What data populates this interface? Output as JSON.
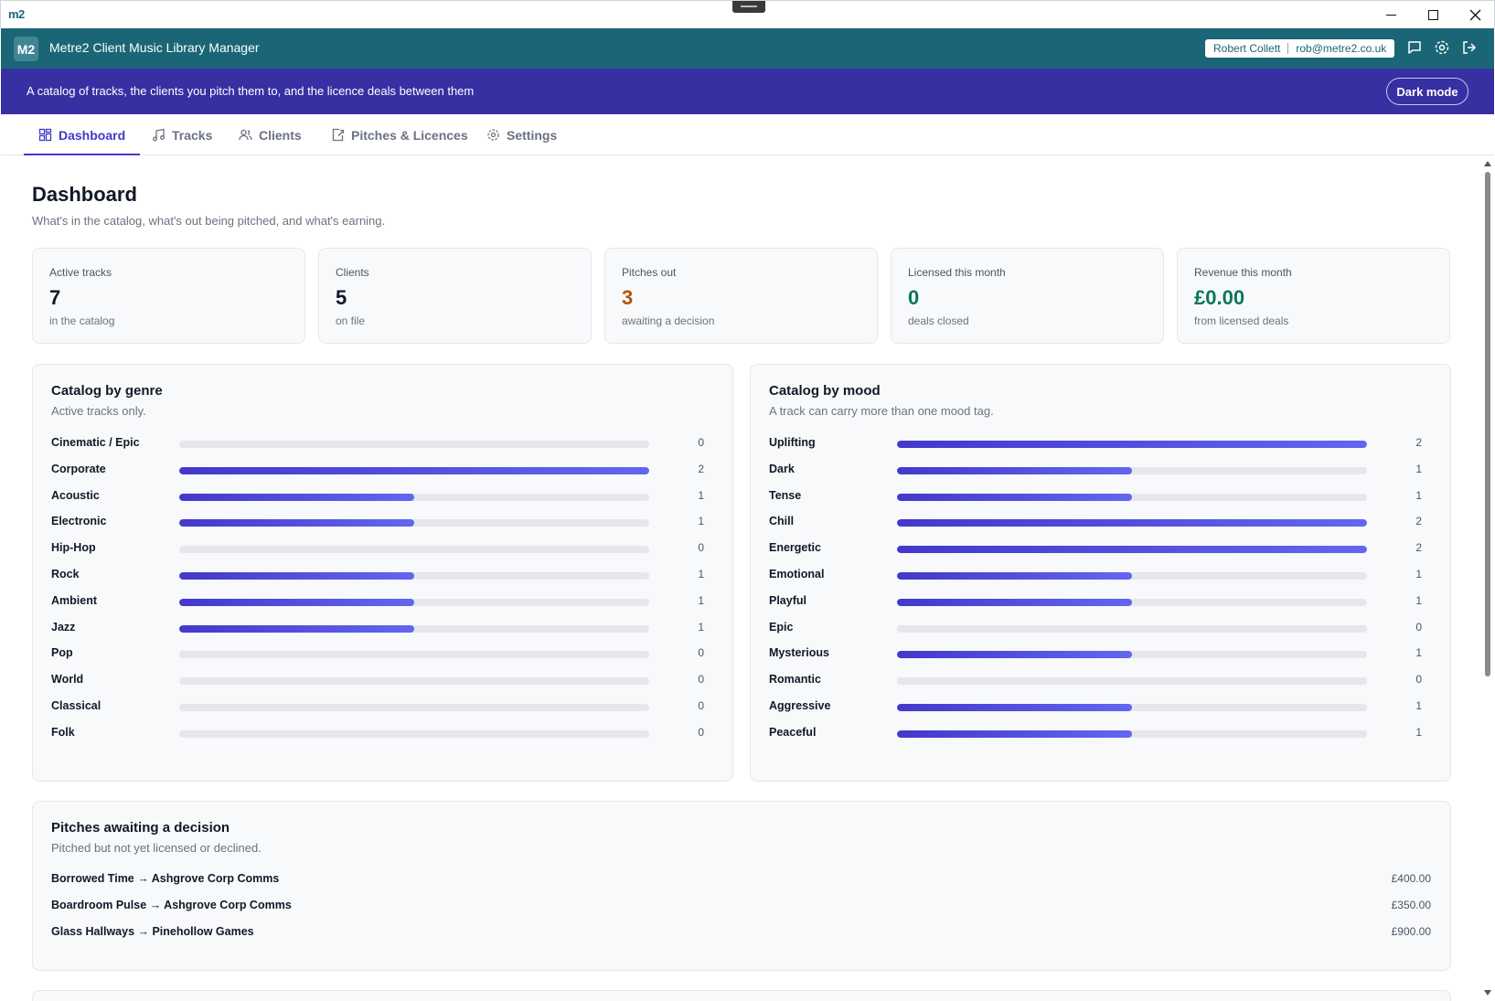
{
  "window": {
    "logo": "m2"
  },
  "header": {
    "badge": "M2",
    "title": "Metre2 Client Music Library Manager",
    "user_name": "Robert Collett",
    "user_email": "rob@metre2.co.uk"
  },
  "banner": {
    "text": "A catalog of tracks, the clients you pitch them to, and the licence deals between them",
    "dark_mode_label": "Dark mode"
  },
  "tabs": [
    {
      "label": "Dashboard",
      "icon": "dashboard-icon",
      "active": true
    },
    {
      "label": "Tracks",
      "icon": "music-note-icon",
      "active": false
    },
    {
      "label": "Clients",
      "icon": "users-icon",
      "active": false
    },
    {
      "label": "Pitches & Licences",
      "icon": "share-icon",
      "active": false
    },
    {
      "label": "Settings",
      "icon": "gear-icon",
      "active": false
    }
  ],
  "page": {
    "title": "Dashboard",
    "subtitle": "What's in the catalog, what's out being pitched, and what's earning."
  },
  "kpis": [
    {
      "label": "Active tracks",
      "value": "7",
      "sub": "in the catalog",
      "color": "#111827"
    },
    {
      "label": "Clients",
      "value": "5",
      "sub": "on file",
      "color": "#111827"
    },
    {
      "label": "Pitches out",
      "value": "3",
      "sub": "awaiting a decision",
      "color": "#b45309"
    },
    {
      "label": "Licensed this month",
      "value": "0",
      "sub": "deals closed",
      "color": "#047857"
    },
    {
      "label": "Revenue this month",
      "value": "£0.00",
      "sub": "from licensed deals",
      "color": "#047857"
    }
  ],
  "genre_panel": {
    "title": "Catalog by genre",
    "subtitle": "Active tracks only.",
    "max": 2,
    "rows": [
      {
        "label": "Cinematic / Epic",
        "count": 0
      },
      {
        "label": "Corporate",
        "count": 2
      },
      {
        "label": "Acoustic",
        "count": 1
      },
      {
        "label": "Electronic",
        "count": 1
      },
      {
        "label": "Hip-Hop",
        "count": 0
      },
      {
        "label": "Rock",
        "count": 1
      },
      {
        "label": "Ambient",
        "count": 1
      },
      {
        "label": "Jazz",
        "count": 1
      },
      {
        "label": "Pop",
        "count": 0
      },
      {
        "label": "World",
        "count": 0
      },
      {
        "label": "Classical",
        "count": 0
      },
      {
        "label": "Folk",
        "count": 0
      }
    ]
  },
  "mood_panel": {
    "title": "Catalog by mood",
    "subtitle": "A track can carry more than one mood tag.",
    "max": 2,
    "rows": [
      {
        "label": "Uplifting",
        "count": 2
      },
      {
        "label": "Dark",
        "count": 1
      },
      {
        "label": "Tense",
        "count": 1
      },
      {
        "label": "Chill",
        "count": 2
      },
      {
        "label": "Energetic",
        "count": 2
      },
      {
        "label": "Emotional",
        "count": 1
      },
      {
        "label": "Playful",
        "count": 1
      },
      {
        "label": "Epic",
        "count": 0
      },
      {
        "label": "Mysterious",
        "count": 1
      },
      {
        "label": "Romantic",
        "count": 0
      },
      {
        "label": "Aggressive",
        "count": 1
      },
      {
        "label": "Peaceful",
        "count": 1
      }
    ]
  },
  "pitches_panel": {
    "title": "Pitches awaiting a decision",
    "subtitle": "Pitched but not yet licensed or declined.",
    "rows": [
      {
        "text": "Borrowed Time → Ashgrove Corp Comms",
        "amount": "£400.00"
      },
      {
        "text": "Boardroom Pulse → Ashgrove Corp Comms",
        "amount": "£350.00"
      },
      {
        "text": "Glass Hallways → Pinehollow Games",
        "amount": "£900.00"
      }
    ]
  },
  "colors": {
    "header_bg": "#1a6677",
    "banner_bg": "#3730a3",
    "accent": "#4338ca",
    "warning": "#b45309",
    "success": "#047857"
  }
}
